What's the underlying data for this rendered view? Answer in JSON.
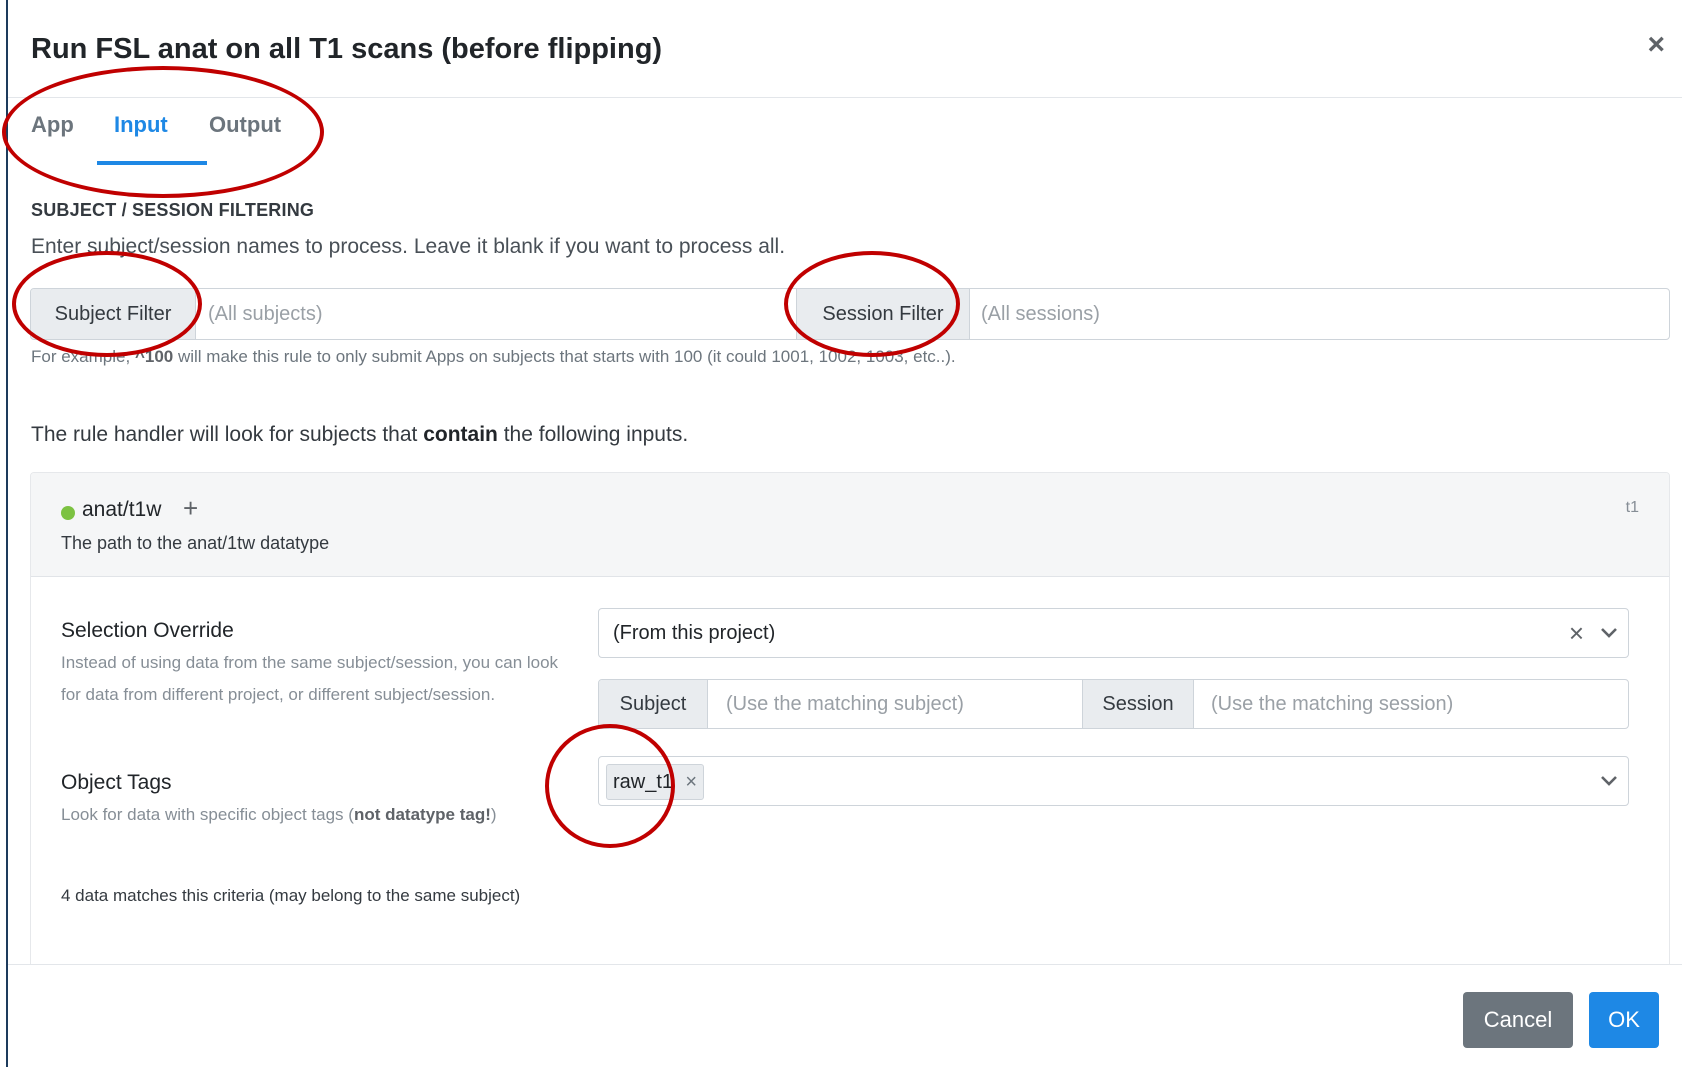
{
  "modal": {
    "title": "Run FSL anat on all T1 scans (before flipping)",
    "close_icon": "×",
    "close_icon_name": "close-icon"
  },
  "tabs": [
    {
      "label": "App",
      "active": false
    },
    {
      "label": "Input",
      "active": true
    },
    {
      "label": "Output",
      "active": false
    }
  ],
  "filtering": {
    "heading": "SUBJECT / SESSION FILTERING",
    "description": "Enter subject/session names to process. Leave it blank if you want to process all.",
    "subject_label": "Subject Filter",
    "subject_placeholder": "(All subjects)",
    "session_label": "Session Filter",
    "session_placeholder": "(All sessions)",
    "help_prefix": "For example, ",
    "help_example": "^100",
    "help_suffix": " will make this rule to only submit Apps on subjects that starts with 100 (it could 1001, 1002, 1003, etc..)."
  },
  "rule_text": {
    "prefix": "The rule handler will look for subjects that ",
    "emphasis": "contain",
    "suffix": " the following inputs."
  },
  "input_card": {
    "id": "anat/t1w",
    "plus_icon": "+",
    "description": "The path to the anat/1tw datatype",
    "tag": "t1",
    "status_color": "#7cc242",
    "selection_override": {
      "label": "Selection Override",
      "help": "Instead of using data from the same subject/session, you can look for data from different project, or different subject/session.",
      "value": "(From this project)",
      "clear_icon": "×"
    },
    "subject_override": {
      "subject_label": "Subject",
      "subject_placeholder": "(Use the matching subject)",
      "session_label": "Session",
      "session_placeholder": "(Use the matching session)"
    },
    "object_tags": {
      "label": "Object Tags",
      "help_prefix": "Look for data with specific object tags (",
      "help_bold": "not datatype tag!",
      "help_suffix": ")",
      "tags": [
        "raw_t1"
      ],
      "remove_icon": "×"
    },
    "matches": "4 data matches this criteria (may belong to the same subject)"
  },
  "footer": {
    "cancel_label": "Cancel",
    "ok_label": "OK"
  },
  "colors": {
    "accent": "#1e88e5",
    "annotation": "#c00000",
    "cancel": "#6c757d"
  }
}
